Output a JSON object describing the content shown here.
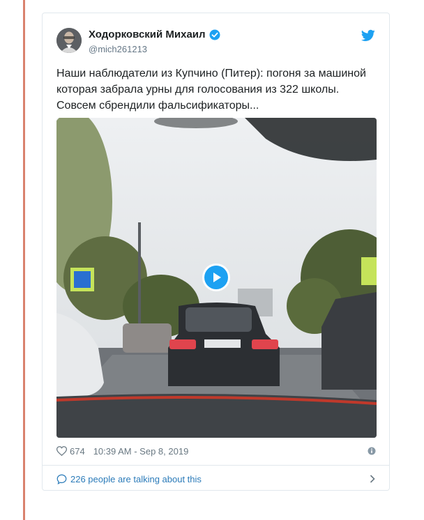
{
  "tweet": {
    "author_name": "Ходорковский Михаил",
    "author_handle": "@mich261213",
    "text": "Наши наблюдатели из Купчино (Питер): погоня за машиной\nкоторая забрала урны для голосования из 322 школы.\nСовсем сбрендили фальсификаторы...",
    "likes": "674",
    "timestamp": "10:39 AM - Sep 8, 2019",
    "talking_text": "226 people are talking about this"
  },
  "colors": {
    "accent": "#1da1f2",
    "link": "#2b7bb9",
    "border": "#e1e8ed",
    "left_rule": "#d9826e"
  },
  "icons": {
    "verified": "verified-badge-icon",
    "brand": "twitter-bird-icon",
    "play": "play-icon",
    "like": "heart-icon",
    "info": "info-icon",
    "comment": "speech-bubble-icon",
    "more": "chevron-right-icon"
  }
}
